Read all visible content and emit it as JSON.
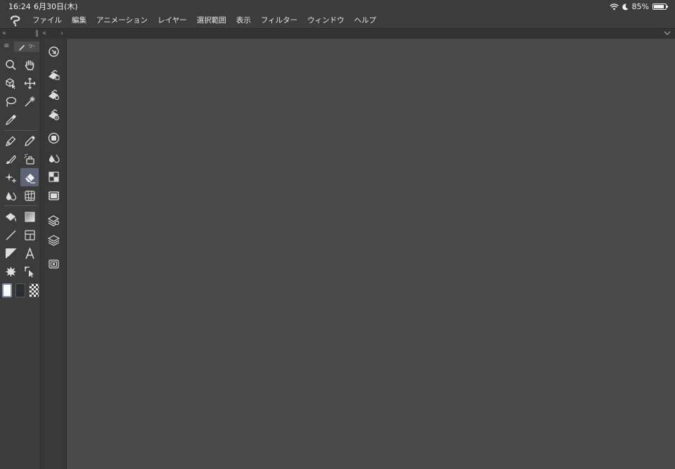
{
  "status": {
    "time": "16:24",
    "date": "6月30日(木)",
    "battery": "85%",
    "battery_level": 0.85
  },
  "menubar": {
    "items": [
      "ファイル",
      "編集",
      "アニメーション",
      "レイヤー",
      "選択範囲",
      "表示",
      "フィルター",
      "ウィンドウ",
      "ヘルプ"
    ]
  },
  "toolpanel": {
    "tab_label": "ツ-",
    "tools": [
      "zoom-icon",
      "hand-icon",
      "operation-icon",
      "move-layer-icon",
      "lasso-select-icon",
      "magic-wand-icon",
      "eyedropper-icon",
      "",
      "pen-icon",
      "pencil-icon",
      "brush-icon",
      "airbrush-icon",
      "decoration-icon",
      "eraser-icon",
      "blend-icon",
      "perspective-ruler-icon",
      "fill-icon",
      "gradient-icon",
      "line-figure-icon",
      "frame-border-icon",
      "balloon-icon",
      "text-icon",
      "flash-icon",
      "correct-line-icon"
    ],
    "selected_tool": "eraser-icon",
    "colors": {
      "main": "#ffffff",
      "sub": "#2b2d33"
    }
  },
  "palettes": [
    "navigator-icon",
    "layer-property-icon",
    "layer-search-icon",
    "layer-search-all-icon",
    "sub-view-icon",
    "color-mixing-icon",
    "color-set-icon",
    "tile-material-icon",
    "layer-stack-icon",
    "layers-icon",
    "animation-cels-icon"
  ]
}
